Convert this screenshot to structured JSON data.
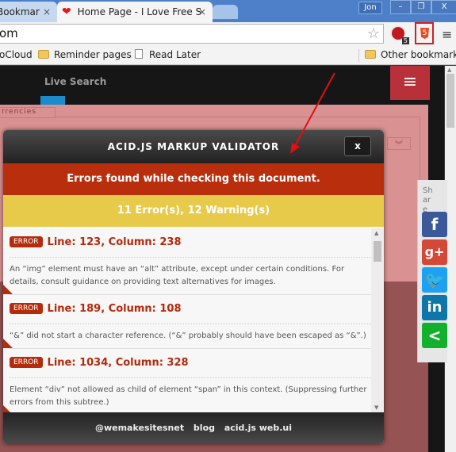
{
  "browser": {
    "tabs": [
      {
        "title": "Bookmar",
        "close": "×"
      },
      {
        "title": "Home Page - I Love Free S",
        "close": "×",
        "favicon": "heart-icon"
      }
    ],
    "profile": "Jon",
    "window_controls": {
      "minimize": "–",
      "restore": "❐",
      "close": "X"
    },
    "url": "om",
    "star": "☆",
    "adblock_count": "5",
    "html5_label": "5",
    "menu_glyph": "≡",
    "bookmarks": [
      {
        "label": "oCloud",
        "icon": "none"
      },
      {
        "label": "Reminder pages",
        "icon": "folder-icon"
      },
      {
        "label": "Read Later",
        "icon": "page-icon"
      }
    ],
    "other_bookmarks": "Other bookmarks"
  },
  "site": {
    "live_search": "Live Search",
    "menu_glyph": "≡",
    "currencies_tab": "rrencies",
    "select_caret": "︾"
  },
  "validator": {
    "title": "ACID.JS MARKUP VALIDATOR",
    "close": "x",
    "alert": "Errors found while checking this document.",
    "summary": "11 Error(s), 12 Warning(s)",
    "errors": [
      {
        "badge": "ERROR",
        "location": "Line: 123, Column: 238",
        "message": "An “img” element must have an “alt” attribute, except under certain conditions. For details, consult guidance on providing text alternatives for images."
      },
      {
        "badge": "ERROR",
        "location": "Line: 189, Column: 108",
        "message": "“&” did not start a character reference. (“&” probably should have been escaped as “&”.)"
      },
      {
        "badge": "ERROR",
        "location": "Line: 1034, Column: 328",
        "message": "Element “div” not allowed as child of element “span” in this context. (Suppressing further errors from this subtree.)"
      }
    ],
    "footer_links": [
      "@wemakesitesnet",
      "blog",
      "acid.js web.ui"
    ]
  },
  "share": {
    "label": "Share",
    "buttons": [
      {
        "name": "facebook",
        "glyph": "f",
        "color": "#3b5998"
      },
      {
        "name": "google-plus",
        "glyph": "g+",
        "color": "#d34836"
      },
      {
        "name": "twitter",
        "glyph": "t",
        "color": "#1da1f2"
      },
      {
        "name": "linkedin",
        "glyph": "in",
        "color": "#0e76a8"
      },
      {
        "name": "share",
        "glyph": "<",
        "color": "#12b12d"
      }
    ]
  },
  "colors": {
    "alert_red": "#b92e0d",
    "summary_yellow": "#e8ca4a",
    "error_text": "#b22a0c"
  }
}
